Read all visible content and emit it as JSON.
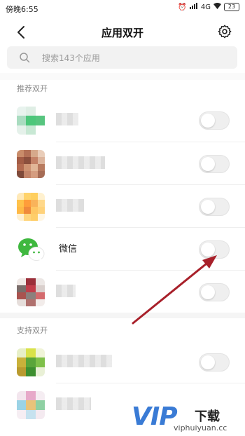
{
  "status_bar": {
    "time": "傍晚6:55",
    "network": "4G",
    "battery": "23"
  },
  "header": {
    "title": "应用双开"
  },
  "search": {
    "placeholder": "搜索143个应用"
  },
  "sections": {
    "recommended": "推荐双开",
    "supported": "支持双开"
  },
  "apps": {
    "wechat": {
      "name": "微信",
      "enabled": false
    }
  },
  "watermark": {
    "logo": "VIP",
    "text": "下载",
    "url": "viphuiyuan.cc"
  },
  "colors": {
    "arrow": "#a8202a",
    "wechat_green": "#3fb83f",
    "watermark_blue": "#3a7bd5"
  }
}
